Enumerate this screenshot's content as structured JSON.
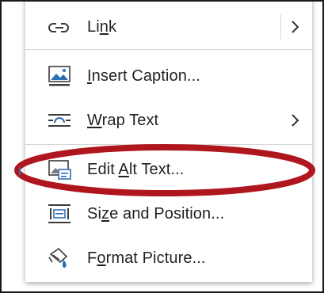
{
  "menu": {
    "items": [
      {
        "id": "link",
        "label_pre": "Li",
        "label_key": "n",
        "label_post": "k",
        "icon": "link-icon",
        "submenu": true
      },
      {
        "id": "insert-caption",
        "label_pre": "",
        "label_key": "I",
        "label_post": "nsert Caption...",
        "icon": "insert-caption-icon",
        "submenu": false
      },
      {
        "id": "wrap-text",
        "label_pre": "",
        "label_key": "W",
        "label_post": "rap Text",
        "icon": "wrap-text-icon",
        "submenu": true
      },
      {
        "id": "edit-alt-text",
        "label_pre": "Edit ",
        "label_key": "A",
        "label_post": "lt Text...",
        "icon": "alt-text-icon",
        "submenu": false
      },
      {
        "id": "size-and-position",
        "label_pre": "Si",
        "label_key": "z",
        "label_post": "e and Position...",
        "icon": "size-position-icon",
        "submenu": false
      },
      {
        "id": "format-picture",
        "label_pre": "F",
        "label_key": "o",
        "label_post": "rmat Picture...",
        "icon": "format-picture-icon",
        "submenu": false
      }
    ]
  },
  "colors": {
    "highlight_ellipse": "#b0161d",
    "icon_blue": "#2f6fb7",
    "icon_dark": "#3c3c3c",
    "text": "#222222"
  }
}
